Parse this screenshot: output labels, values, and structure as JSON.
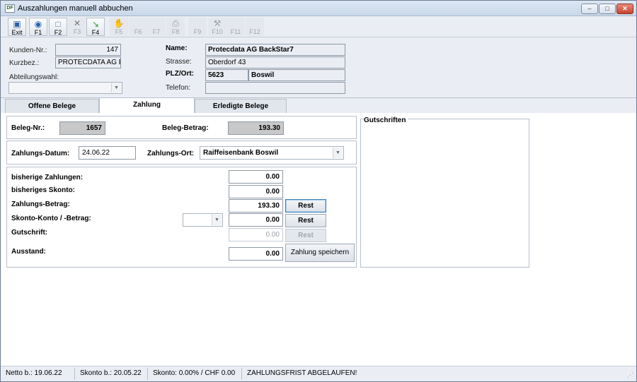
{
  "window": {
    "title": "Auszahlungen manuell abbuchen",
    "app_icon_text": "DF",
    "minimize_glyph": "–",
    "maximize_glyph": "□",
    "close_glyph": "✕"
  },
  "toolbar": {
    "buttons": [
      {
        "label": "Exit",
        "icon": "exit-door-icon",
        "glyph": "▣",
        "color": "#2a5fa8",
        "enabled": true
      },
      {
        "label": "F1",
        "icon": "help-icon",
        "glyph": "◉",
        "color": "#2a5fa8",
        "enabled": true
      },
      {
        "label": "F2",
        "icon": "new-document-icon",
        "glyph": "□",
        "color": "#5a7da8",
        "enabled": true
      },
      {
        "label": "F3",
        "icon": "delete-cross-icon",
        "glyph": "✕",
        "color": "#777777",
        "enabled": false
      },
      {
        "label": "F4",
        "icon": "green-arrow-icon",
        "glyph": "↘",
        "color": "#2e9a2e",
        "enabled": true
      },
      {
        "label": "F5",
        "icon": "hand-icon",
        "glyph": "✋",
        "color": "#9aa0a8",
        "enabled": false
      },
      {
        "label": "F6",
        "icon": "blank-icon",
        "glyph": "",
        "color": "#9aa0a8",
        "enabled": false
      },
      {
        "label": "F7",
        "icon": "blank-icon",
        "glyph": "",
        "color": "#9aa0a8",
        "enabled": false
      },
      {
        "label": "F8",
        "icon": "printer-icon",
        "glyph": "⎙",
        "color": "#9aa0a8",
        "enabled": false
      },
      {
        "label": "F9",
        "icon": "blank-icon",
        "glyph": "",
        "color": "#9aa0a8",
        "enabled": false
      },
      {
        "label": "F10",
        "icon": "tools-icon",
        "glyph": "⚒",
        "color": "#9aa0a8",
        "enabled": false
      },
      {
        "label": "F11",
        "icon": "blank-icon",
        "glyph": "",
        "color": "#9aa0a8",
        "enabled": false
      },
      {
        "label": "F12",
        "icon": "blank-icon",
        "glyph": "",
        "color": "#9aa0a8",
        "enabled": false
      }
    ]
  },
  "header": {
    "kunden_nr_label": "Kunden-Nr.:",
    "kunden_nr_value": "147",
    "kurzbez_label": "Kurzbez.:",
    "kurzbez_value": "PROTECDATA AG B",
    "abteilung_label": "Abteilungswahl:",
    "abteilung_value": "",
    "name_label": "Name:",
    "name_value": "Protecdata AG BackStar7",
    "strasse_label": "Strasse:",
    "strasse_value": "Oberdorf 43",
    "plz_label": "PLZ/Ort:",
    "plz_value": "5623",
    "ort_value": "Boswil",
    "telefon_label": "Telefon:",
    "telefon_value": ""
  },
  "tabs": [
    {
      "label": "Offene Belege",
      "active": false
    },
    {
      "label": "Zahlung",
      "active": true
    },
    {
      "label": "Erledigte Belege",
      "active": false
    }
  ],
  "beleg": {
    "nr_label": "Beleg-Nr.:",
    "nr_value": "1657",
    "betrag_label": "Beleg-Betrag:",
    "betrag_value": "193.30"
  },
  "zahlung": {
    "datum_label": "Zahlungs-Datum:",
    "datum_value": "24.06.22",
    "ort_label": "Zahlungs-Ort:",
    "ort_value": "Raiffeisenbank Boswil"
  },
  "betraege": {
    "bisherige_zahlungen_label": "bisherige Zahlungen:",
    "bisherige_zahlungen_value": "0.00",
    "bisheriges_skonto_label": "bisheriges Skonto:",
    "bisheriges_skonto_value": "0.00",
    "zahlungs_betrag_label": "Zahlungs-Betrag:",
    "zahlungs_betrag_value": "193.30",
    "skonto_label": "Skonto-Konto / -Betrag:",
    "skonto_konto_value": "",
    "skonto_betrag_value": "0.00",
    "gutschrift_label": "Gutschrift:",
    "gutschrift_value": "0.00",
    "ausstand_label": "Ausstand:",
    "ausstand_value": "0.00",
    "rest_label": "Rest",
    "speichern_label": "Zahlung speichern"
  },
  "gutschriften": {
    "title": "Gutschriften"
  },
  "statusbar": {
    "netto": "Netto b.: 19.06.22",
    "skonto_bis": "Skonto b.: 20.05.22",
    "skonto": "Skonto: 0.00% / CHF 0.00",
    "message": "ZAHLUNGSFRIST ABGELAUFEN!"
  }
}
